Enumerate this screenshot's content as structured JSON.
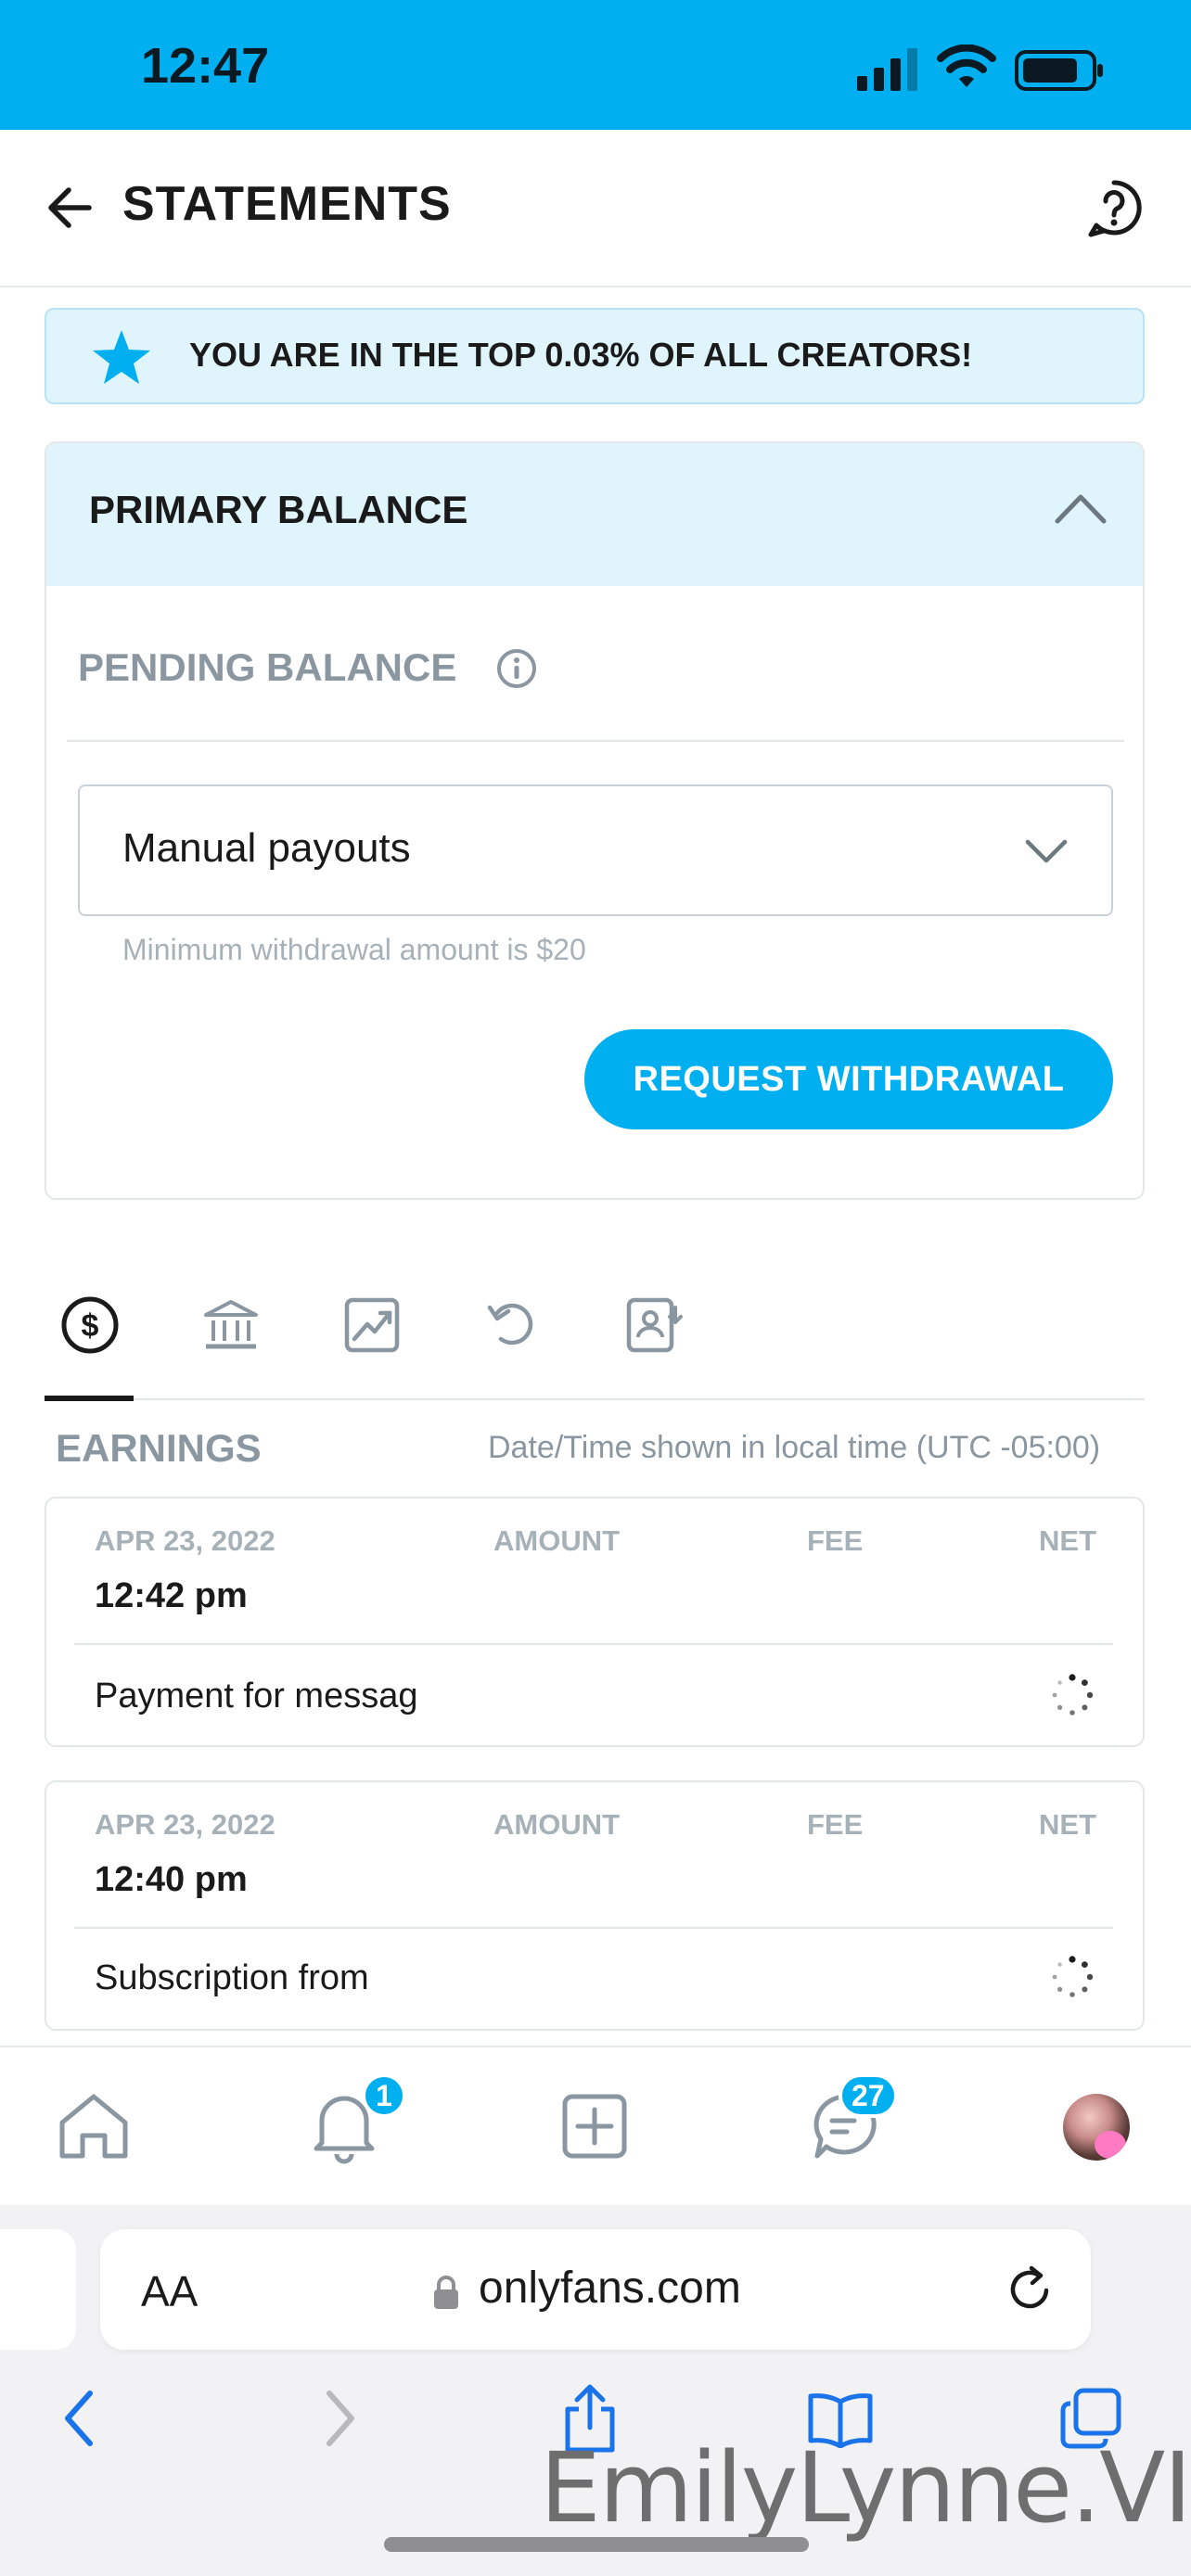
{
  "status_bar": {
    "time": "12:47"
  },
  "header": {
    "title": "STATEMENTS"
  },
  "banner": {
    "text": "YOU ARE IN THE TOP 0.03% OF ALL CREATORS!"
  },
  "balance_card": {
    "title": "PRIMARY BALANCE",
    "pending_label": "PENDING BALANCE",
    "payout_select": {
      "value": "Manual payouts"
    },
    "min_note": "Minimum withdrawal amount is $20",
    "withdraw_button": "REQUEST WITHDRAWAL"
  },
  "tabs": [
    {
      "icon": "dollar-circle-icon",
      "active": true
    },
    {
      "icon": "bank-icon",
      "active": false
    },
    {
      "icon": "chart-icon",
      "active": false
    },
    {
      "icon": "undo-icon",
      "active": false
    },
    {
      "icon": "profile-download-icon",
      "active": false
    }
  ],
  "earnings": {
    "label": "EARNINGS",
    "tz_note": "Date/Time shown in local time (UTC -05:00)",
    "columns": {
      "amount": "AMOUNT",
      "fee": "FEE",
      "net": "NET"
    },
    "rows": [
      {
        "date": "APR 23, 2022",
        "time": "12:42 pm",
        "description": "Payment for messag"
      },
      {
        "date": "APR 23, 2022",
        "time": "12:40 pm",
        "description": "Subscription from"
      }
    ]
  },
  "bottom_nav": {
    "notifications_badge": "1",
    "messages_badge": "27"
  },
  "browser": {
    "aa_label": "AA",
    "url": "onlyfans.com"
  },
  "watermark": "EmilyLynne.VIP",
  "colors": {
    "accent": "#00aff0",
    "banner_bg": "#dff4fb",
    "muted_text": "#8a96a0"
  }
}
